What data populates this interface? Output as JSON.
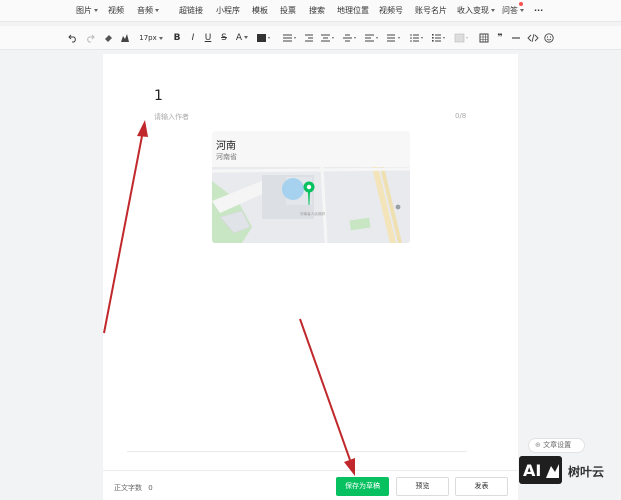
{
  "menu": {
    "items": [
      {
        "label": "图片",
        "dropdown": true
      },
      {
        "label": "视频",
        "dropdown": false
      },
      {
        "label": "音频",
        "dropdown": true
      },
      {
        "label": "超链接",
        "dropdown": false
      },
      {
        "label": "小程序",
        "dropdown": false
      },
      {
        "label": "模板",
        "dropdown": false
      },
      {
        "label": "投票",
        "dropdown": false
      },
      {
        "label": "搜索",
        "dropdown": false
      },
      {
        "label": "地理位置",
        "dropdown": false
      },
      {
        "label": "视频号",
        "dropdown": false
      },
      {
        "label": "账号名片",
        "dropdown": false
      },
      {
        "label": "收入变现",
        "dropdown": true
      },
      {
        "label": "问答",
        "dropdown": true
      }
    ],
    "more": "···"
  },
  "toolbar": {
    "font_size": "17px",
    "bold": "B",
    "italic": "I",
    "underline": "U",
    "strike": "S",
    "font_color": "A",
    "quote": "❞"
  },
  "editor": {
    "title": "1",
    "author_placeholder": "请输入作者",
    "author_count": "0/8",
    "location": {
      "name": "河南",
      "subtitle": "河南省",
      "map_label": "河南省人民政府"
    }
  },
  "footer": {
    "word_count_label": "正文字数",
    "word_count": "0",
    "save_label": "保存为草稿",
    "preview_label": "预览",
    "publish_label": "发表",
    "settings_label": "文章设置"
  },
  "watermark": {
    "badge": "AI",
    "text": "树叶云"
  },
  "colors": {
    "accent_green": "#07c160",
    "arrow_red": "#c0282b",
    "notify_red": "#fa5151"
  }
}
